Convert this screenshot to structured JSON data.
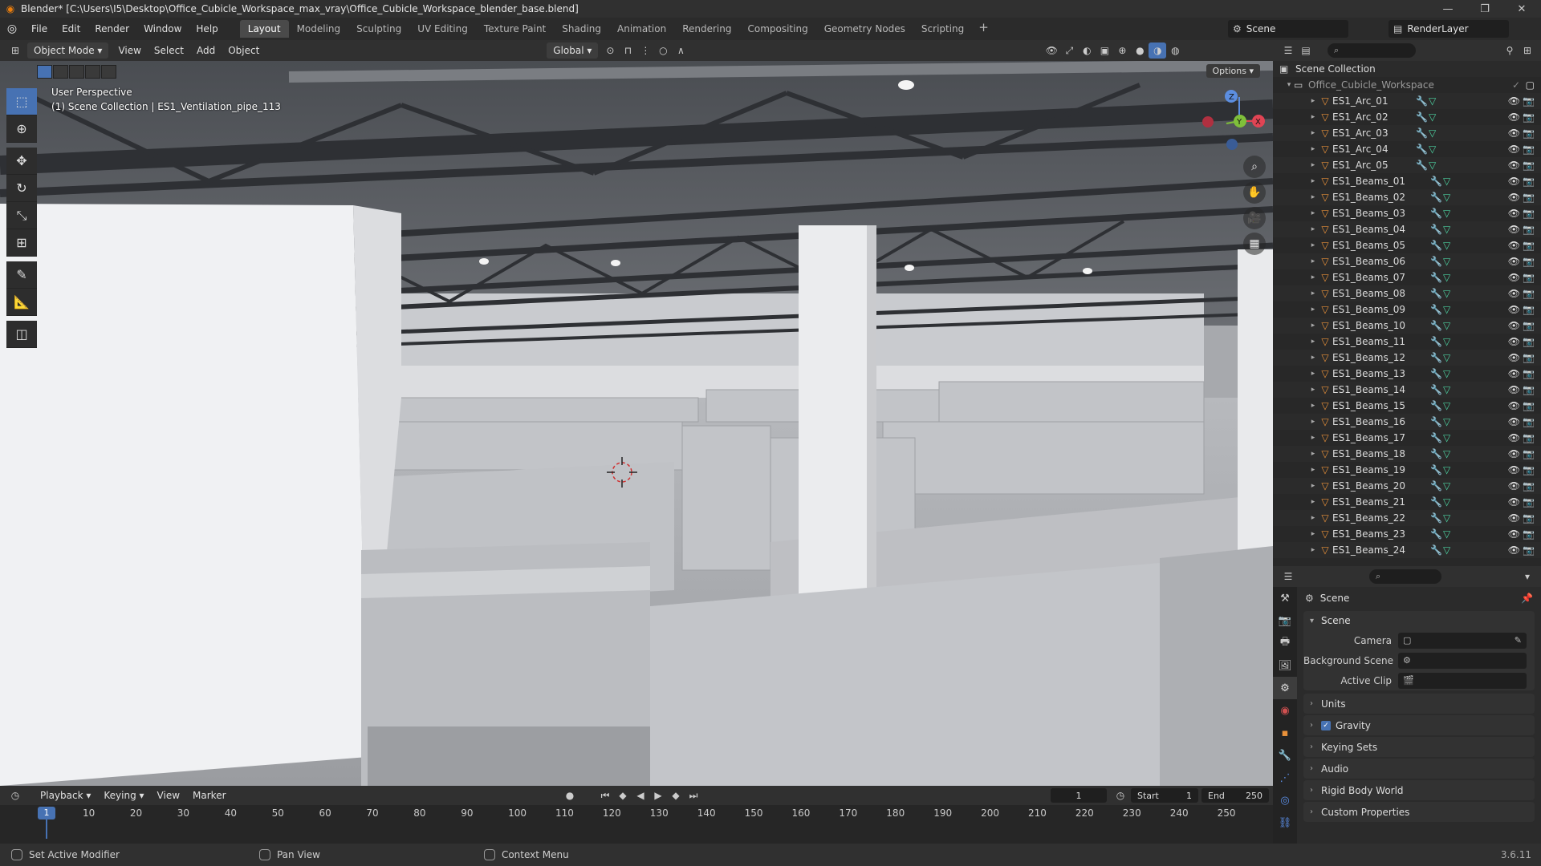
{
  "window": {
    "title": "Blender* [C:\\Users\\I5\\Desktop\\Office_Cubicle_Workspace_max_vray\\Office_Cubicle_Workspace_blender_base.blend]",
    "minimize": "—",
    "maximize": "❐",
    "close": "✕"
  },
  "menu": [
    "File",
    "Edit",
    "Render",
    "Window",
    "Help"
  ],
  "workspaces": [
    "Layout",
    "Modeling",
    "Sculpting",
    "UV Editing",
    "Texture Paint",
    "Shading",
    "Animation",
    "Rendering",
    "Compositing",
    "Geometry Nodes",
    "Scripting"
  ],
  "active_workspace": "Layout",
  "scene_name": "Scene",
  "view_layer": "RenderLayer",
  "viewport_header": {
    "mode": "Object Mode",
    "menus": [
      "View",
      "Select",
      "Add",
      "Object"
    ],
    "orientation": "Global",
    "options": "Options"
  },
  "viewport": {
    "view_name": "User Perspective",
    "collection_info": "(1) Scene Collection | ES1_Ventilation_pipe_113"
  },
  "tools": [
    "select-box",
    "cursor",
    "move",
    "rotate",
    "scale",
    "transform",
    "annotate",
    "measure",
    "add-cube"
  ],
  "outliner": {
    "root": "Scene Collection",
    "collection": "Office_Cubicle_Workspace",
    "objects": [
      "ES1_Arc_01",
      "ES1_Arc_02",
      "ES1_Arc_03",
      "ES1_Arc_04",
      "ES1_Arc_05",
      "ES1_Beams_01",
      "ES1_Beams_02",
      "ES1_Beams_03",
      "ES1_Beams_04",
      "ES1_Beams_05",
      "ES1_Beams_06",
      "ES1_Beams_07",
      "ES1_Beams_08",
      "ES1_Beams_09",
      "ES1_Beams_10",
      "ES1_Beams_11",
      "ES1_Beams_12",
      "ES1_Beams_13",
      "ES1_Beams_14",
      "ES1_Beams_15",
      "ES1_Beams_16",
      "ES1_Beams_17",
      "ES1_Beams_18",
      "ES1_Beams_19",
      "ES1_Beams_20",
      "ES1_Beams_21",
      "ES1_Beams_22",
      "ES1_Beams_23",
      "ES1_Beams_24"
    ]
  },
  "properties": {
    "context_title": "Scene",
    "panel_title": "Scene",
    "rows": [
      {
        "label": "Camera",
        "value": ""
      },
      {
        "label": "Background Scene",
        "value": ""
      },
      {
        "label": "Active Clip",
        "value": ""
      }
    ],
    "collapsed_panels": [
      "Units",
      "Gravity",
      "Keying Sets",
      "Audio",
      "Rigid Body World",
      "Custom Properties"
    ],
    "gravity_checked": true
  },
  "timeline": {
    "menus": [
      "Playback",
      "Keying",
      "View",
      "Marker"
    ],
    "current_frame": "1",
    "start_label": "Start",
    "start_value": "1",
    "end_label": "End",
    "end_value": "250",
    "ticks": [
      "10",
      "20",
      "30",
      "40",
      "50",
      "60",
      "70",
      "80",
      "90",
      "100",
      "110",
      "120",
      "130",
      "140",
      "150",
      "160",
      "170",
      "180",
      "190",
      "200",
      "210",
      "220",
      "230",
      "240",
      "250"
    ]
  },
  "statusbar": {
    "items": [
      "Set Active Modifier",
      "Pan View",
      "Context Menu"
    ],
    "version": "3.6.11"
  },
  "colors": {
    "accent": "#4772b3",
    "object_icon": "#e8913a",
    "mesh_icon": "#4cd1a0",
    "blender_orange": "#e87d0d"
  }
}
